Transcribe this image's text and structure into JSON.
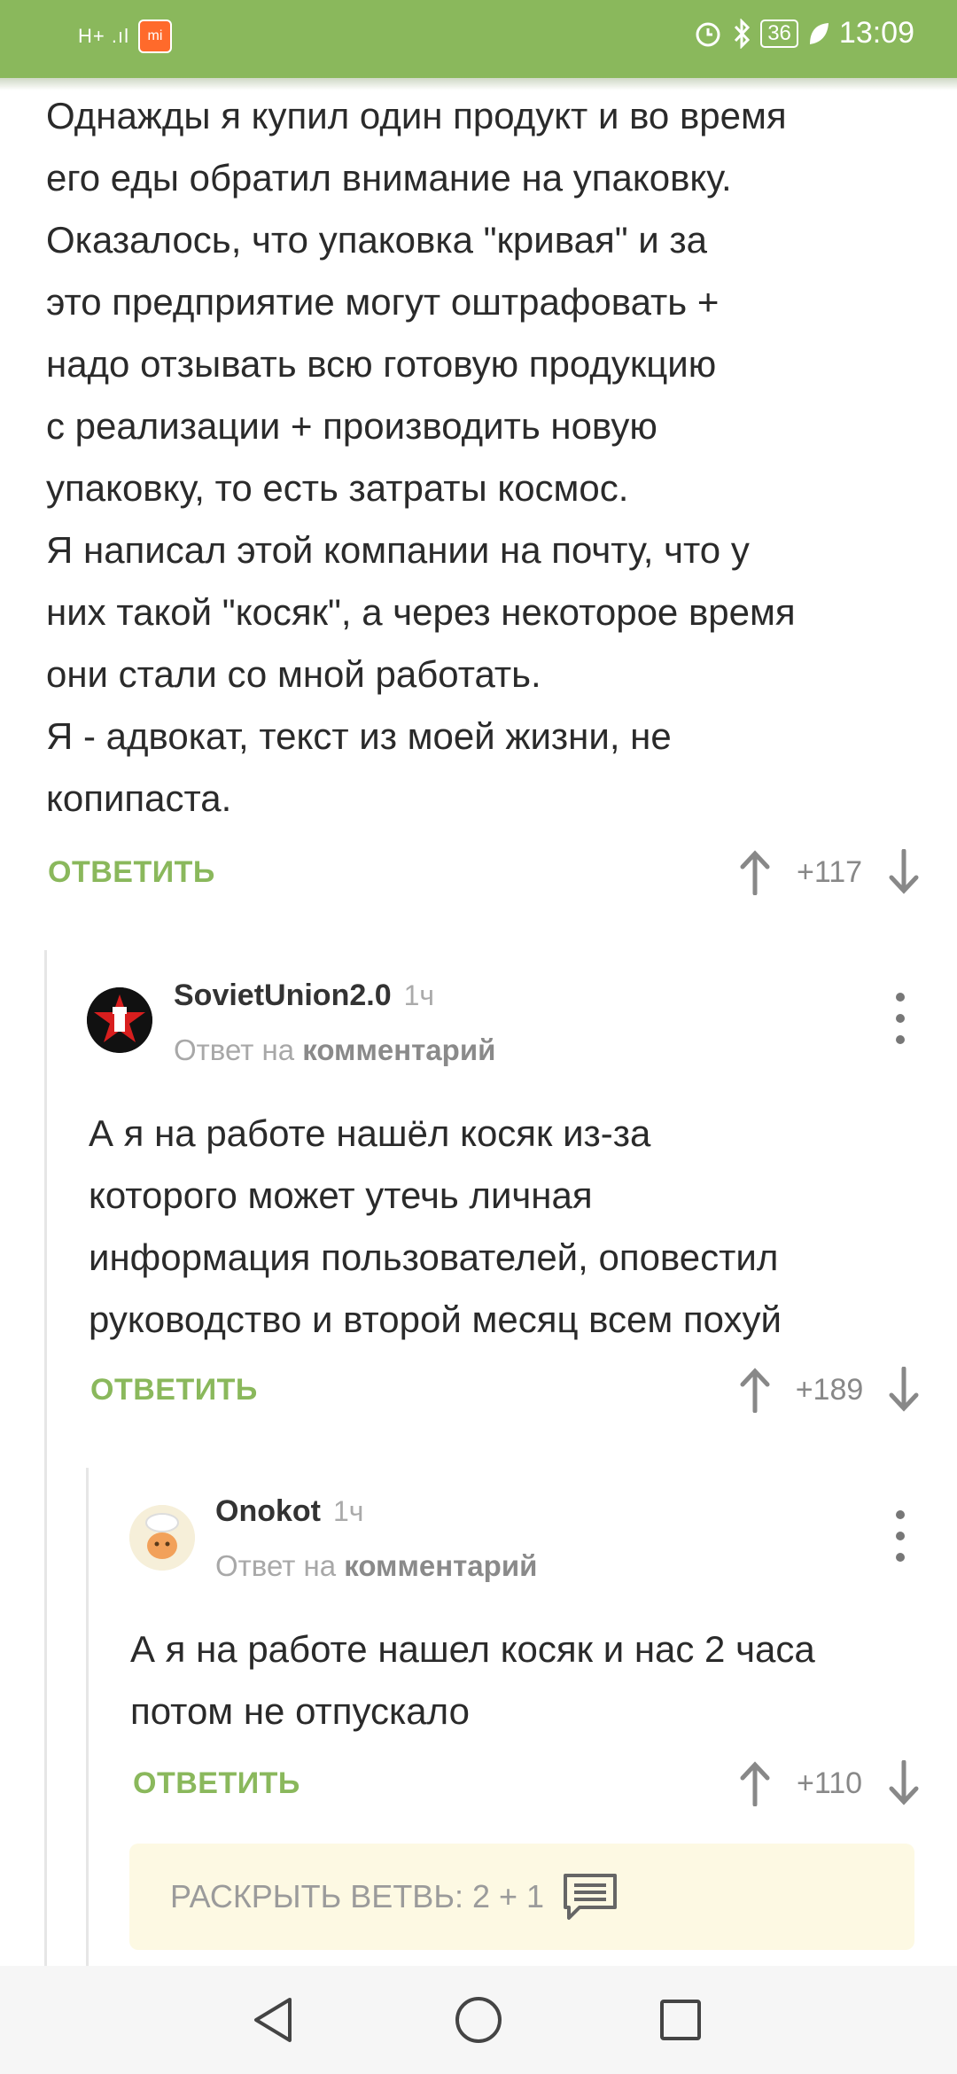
{
  "status_bar": {
    "signal": "H+ .ıl",
    "app_badge": "mi",
    "battery": "36",
    "time": "13:09"
  },
  "article": {
    "lines": [
      "Однажды я купил один продукт и во время",
      "его еды обратил внимание на упаковку.",
      "Оказалось, что упаковка \"кривая\" и за",
      "это предприятие могут оштрафовать +",
      "надо отзывать всю готовую продукцию",
      "с реализации + производить новую",
      "упаковку, то есть затраты космос.",
      "Я написал этой компании на почту, что у",
      "них такой \"косяк\", а через некоторое время",
      "они стали со мной работать.",
      "Я - адвокат, текст из моей жизни, не",
      "копипаста."
    ],
    "reply_label": "ОТВЕТИТЬ",
    "votes": "+117"
  },
  "comments": [
    {
      "username": "SovietUnion2.0",
      "time": "1ч",
      "reply_to_prefix": "Ответ на",
      "reply_to_link": "комментарий",
      "lines": [
        "А я на работе нашёл косяк из-за",
        "которого может утечь личная",
        "информация пользователей, оповестил",
        "руководство и второй месяц всем похуй"
      ],
      "reply_label": "ОТВЕТИТЬ",
      "votes": "+189"
    },
    {
      "username": "Onokot",
      "time": "1ч",
      "reply_to_prefix": "Ответ на",
      "reply_to_link": "комментарий",
      "lines": [
        "А я на работе нашел косяк и нас 2 часа",
        "потом не отпускало"
      ],
      "reply_label": "ОТВЕТИТЬ",
      "votes": "+110"
    }
  ],
  "expand_branch": {
    "label": "РАСКРЫТЬ ВЕТВЬ: 2 + 1"
  },
  "colors": {
    "accent": "#8ab85c",
    "expand_bg": "#fdf9e3"
  }
}
